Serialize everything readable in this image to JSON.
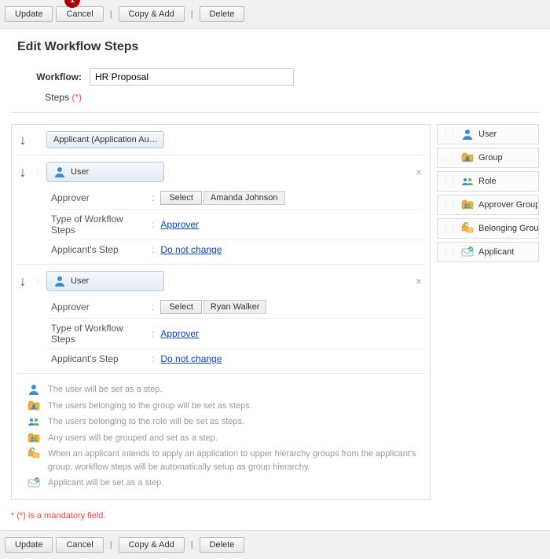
{
  "badge": "1",
  "toolbar": {
    "update": "Update",
    "cancel": "Cancel",
    "copyadd": "Copy & Add",
    "delete": "Delete"
  },
  "title": "Edit Workflow Steps",
  "form": {
    "workflow_label": "Workflow:",
    "workflow_value": "HR Proposal",
    "steps_label": "Steps",
    "steps_req": "(*)"
  },
  "steps": [
    {
      "chip_type": "applicant",
      "chip_label": "Applicant (Application Au…",
      "closable": false,
      "details": []
    },
    {
      "chip_type": "user",
      "chip_label": "User",
      "closable": true,
      "details": {
        "approver_label": "Approver",
        "select_label": "Select",
        "approver_value": "Amanda Johnson",
        "type_label": "Type of Workflow Steps",
        "type_value": "Approver",
        "applicant_step_label": "Applicant's Step",
        "applicant_step_value": "Do not change"
      }
    },
    {
      "chip_type": "user",
      "chip_label": "User",
      "closable": true,
      "details": {
        "approver_label": "Approver",
        "select_label": "Select",
        "approver_value": "Ryan Walker",
        "type_label": "Type of Workflow Steps",
        "type_value": "Approver",
        "applicant_step_label": "Applicant's Step",
        "applicant_step_value": "Do not change"
      }
    }
  ],
  "legend": [
    {
      "icon": "user",
      "text": "The user will be set as a step."
    },
    {
      "icon": "group",
      "text": "The users belonging to the group will be set as steps."
    },
    {
      "icon": "role",
      "text": "The users belonging to the role will be set as steps."
    },
    {
      "icon": "approver-group",
      "text": "Any users will be grouped and set as a step."
    },
    {
      "icon": "belonging-group",
      "text": "When an applicant intends to apply an application to upper hierarchy groups from the applicant's group, workflow steps will be automatically setup as group hierarchy."
    },
    {
      "icon": "applicant",
      "text": "Applicant will be set as a step."
    }
  ],
  "palette": [
    {
      "icon": "user",
      "label": "User"
    },
    {
      "icon": "group",
      "label": "Group"
    },
    {
      "icon": "role",
      "label": "Role"
    },
    {
      "icon": "approver-group",
      "label": "Approver Group"
    },
    {
      "icon": "belonging-group",
      "label": "Belonging Grou…"
    },
    {
      "icon": "applicant",
      "label": "Applicant"
    }
  ],
  "mandatory_note": "* (*) is a mandatory field.",
  "detail_separator": ":"
}
